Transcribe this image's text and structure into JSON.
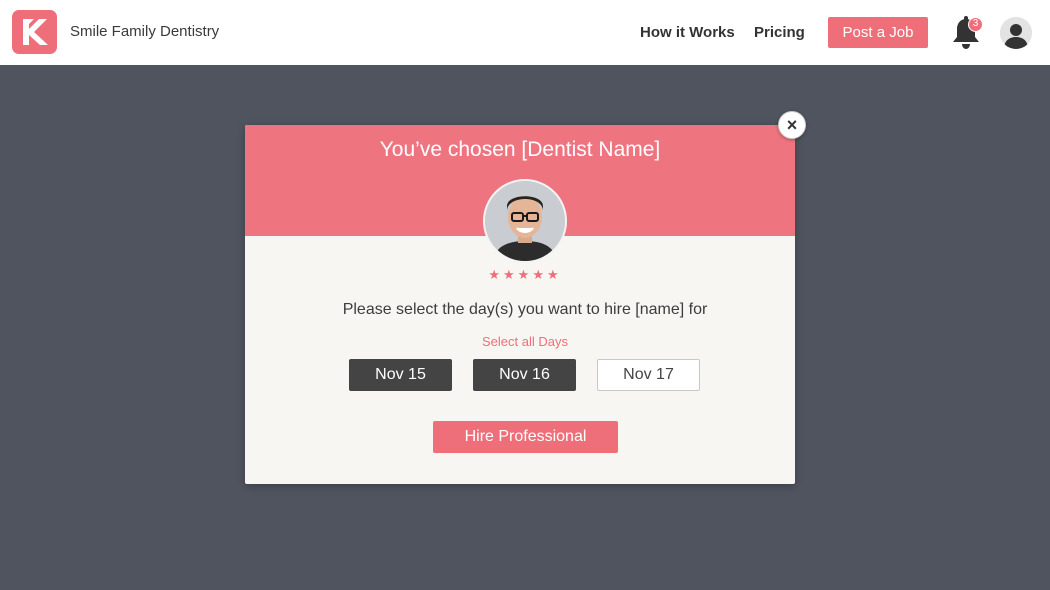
{
  "header": {
    "org_name": "Smile Family Dentistry",
    "nav": {
      "how_it_works": "How it Works",
      "pricing": "Pricing"
    },
    "post_job_label": "Post a Job",
    "notification_count": "3",
    "logo_icon": "k-logo-icon",
    "bell_icon": "bell-icon",
    "user_icon": "user-avatar-icon"
  },
  "modal": {
    "title": "You’ve chosen [Dentist Name]",
    "close_label": "×",
    "rating_text": "★★★★★",
    "prompt": "Please select the day(s) you want to hire [name] for",
    "select_all_label": "Select all Days",
    "days": [
      {
        "label": "Nov 15",
        "selected": true
      },
      {
        "label": "Nov 16",
        "selected": true
      },
      {
        "label": "Nov 17",
        "selected": false
      }
    ],
    "hire_label": "Hire Professional"
  },
  "colors": {
    "brand": "#ee6f79",
    "modal_header": "#ee747f",
    "backdrop": "#4f545e",
    "selected_day": "#444444"
  }
}
